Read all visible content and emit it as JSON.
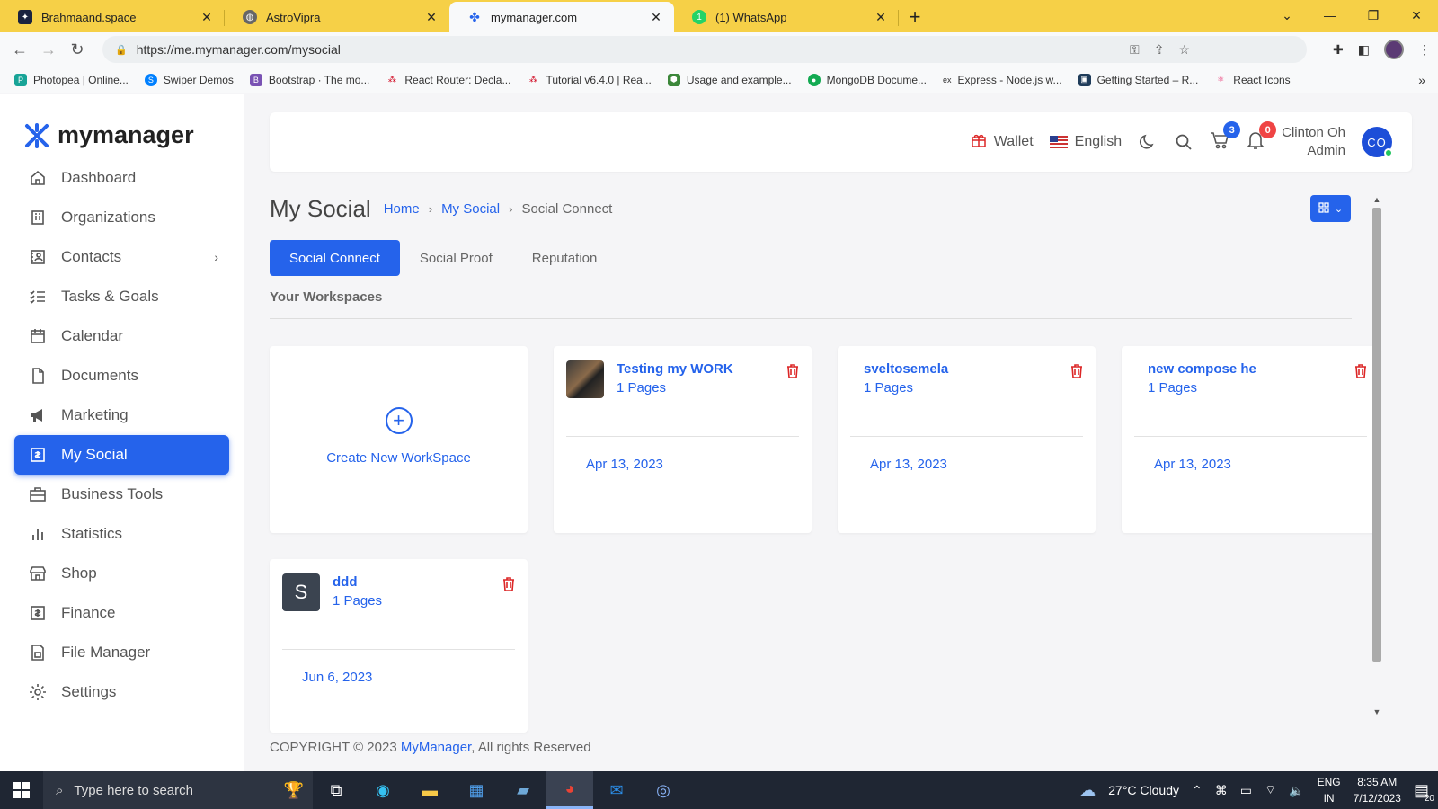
{
  "browser": {
    "tabs": [
      {
        "title": "Brahmaand.space",
        "icon": "brahmaand-favicon",
        "color": "#1a2340"
      },
      {
        "title": "AstroVipra",
        "icon": "globe-favicon",
        "color": "#555555"
      },
      {
        "title": "mymanager.com",
        "icon": "mymanager-favicon",
        "color": "#2563eb"
      },
      {
        "title": "(1) WhatsApp",
        "icon": "whatsapp-favicon",
        "color": "#25d366"
      }
    ],
    "new_tab_label": "+",
    "url": "https://me.mymanager.com/mysocial",
    "bookmarks": [
      {
        "label": "Photopea | Online...",
        "color": "#18a497"
      },
      {
        "label": "Swiper Demos",
        "color": "#0080ff"
      },
      {
        "label": "Bootstrap · The mo...",
        "color": "#7952b3"
      },
      {
        "label": "React Router: Decla...",
        "color": "#d0021b"
      },
      {
        "label": "Tutorial v6.4.0 | Rea...",
        "color": "#d0021b"
      },
      {
        "label": "Usage and example...",
        "color": "#3c873a"
      },
      {
        "label": "MongoDB Docume...",
        "color": "#13aa52"
      },
      {
        "label": "Express - Node.js w...",
        "color": "#333333"
      },
      {
        "label": "Getting Started – R...",
        "color": "#1f3c5a"
      },
      {
        "label": "React Icons",
        "color": "#e91e63"
      }
    ],
    "bookmarks_more": "»"
  },
  "sidebar": {
    "brand": "mymanager",
    "items": [
      {
        "label": "Dashboard",
        "icon": "home-icon"
      },
      {
        "label": "Organizations",
        "icon": "building-icon"
      },
      {
        "label": "Contacts",
        "icon": "contacts-icon"
      },
      {
        "label": "Tasks & Goals",
        "icon": "tasks-icon"
      },
      {
        "label": "Calendar",
        "icon": "calendar-icon"
      },
      {
        "label": "Documents",
        "icon": "document-icon"
      },
      {
        "label": "Marketing",
        "icon": "megaphone-icon"
      },
      {
        "label": "My Social",
        "icon": "social-icon"
      },
      {
        "label": "Business Tools",
        "icon": "briefcase-icon"
      },
      {
        "label": "Statistics",
        "icon": "bar-chart-icon"
      },
      {
        "label": "Shop",
        "icon": "store-icon"
      },
      {
        "label": "Finance",
        "icon": "finance-icon"
      },
      {
        "label": "File Manager",
        "icon": "file-manager-icon"
      },
      {
        "label": "Settings",
        "icon": "gear-icon"
      }
    ],
    "active": "My Social"
  },
  "header": {
    "wallet": "Wallet",
    "language": "English",
    "cart_count": "3",
    "notification_count": "0",
    "user_name": "Clinton Oh",
    "user_role": "Admin",
    "user_initials": "CO"
  },
  "page": {
    "title": "My Social",
    "breadcrumb": [
      "Home",
      "My Social",
      "Social Connect"
    ],
    "tabs": [
      "Social Connect",
      "Social Proof",
      "Reputation"
    ],
    "section_title": "Your Workspaces",
    "create_label": "Create New WorkSpace",
    "workspaces": [
      {
        "name": "Testing my WORK",
        "pages": "1 Pages",
        "date": "Apr 13, 2023",
        "thumb": "image"
      },
      {
        "name": "sveltosemela",
        "pages": "1 Pages",
        "date": "Apr 13, 2023",
        "thumb": "none"
      },
      {
        "name": "new compose he",
        "pages": "1 Pages",
        "date": "Apr 13, 2023",
        "thumb": "none"
      },
      {
        "name": "ddd",
        "pages": "1 Pages",
        "date": "Jun 6, 2023",
        "thumb": "S"
      }
    ],
    "footer_prefix": "COPYRIGHT © 2023 ",
    "footer_link": "MyManager",
    "footer_suffix": ", All rights Reserved"
  },
  "taskbar": {
    "search_placeholder": "Type here to search",
    "weather": "27°C  Cloudy",
    "lang_top": "ENG",
    "lang_bottom": "IN",
    "time": "8:35 AM",
    "date": "7/12/2023",
    "notif_count": "20"
  },
  "colors": {
    "accent": "#2563eb",
    "danger": "#dc2626",
    "tabbar": "#f6d047"
  }
}
